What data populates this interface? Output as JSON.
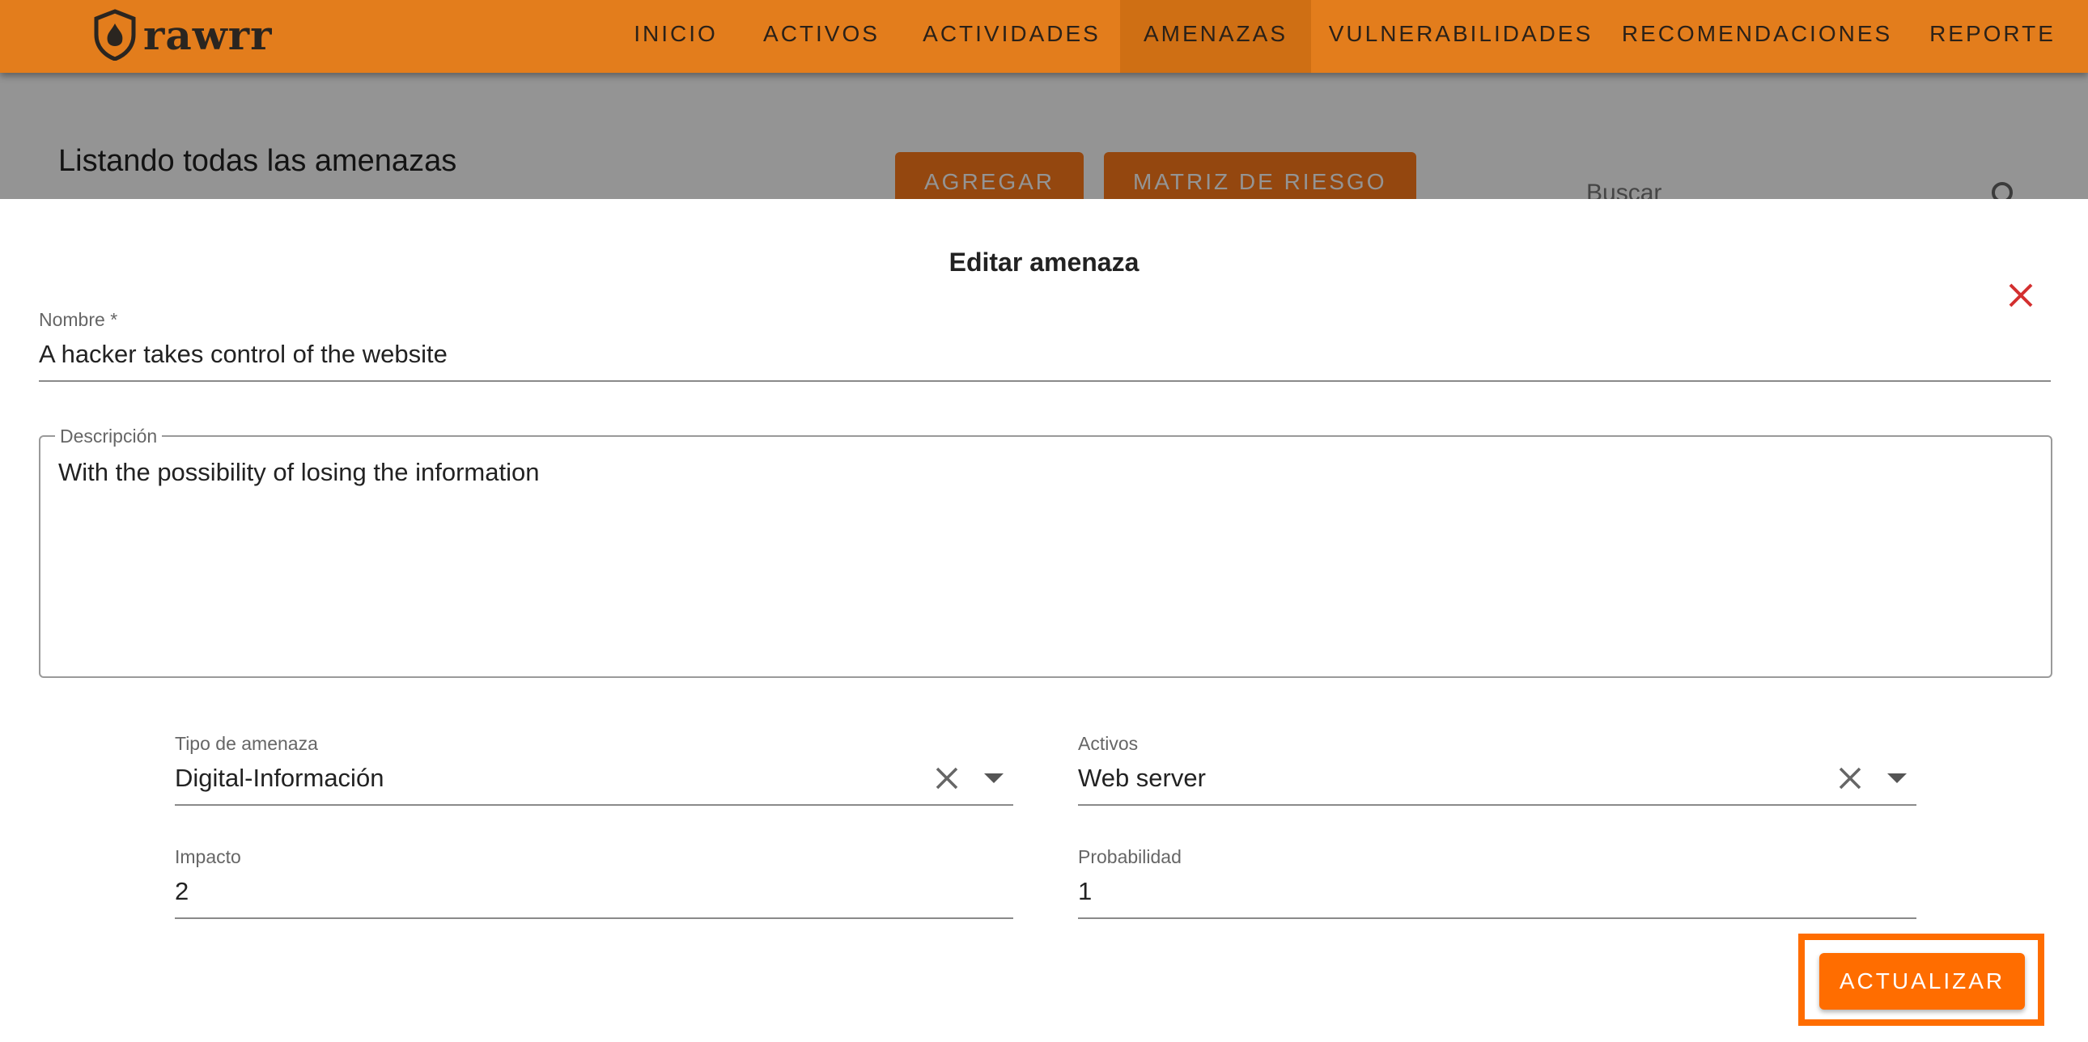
{
  "brand": {
    "name": "rawrr"
  },
  "nav": {
    "items": [
      {
        "label": "INICIO"
      },
      {
        "label": "ACTIVOS"
      },
      {
        "label": "ACTIVIDADES"
      },
      {
        "label": "AMENAZAS",
        "active": true
      },
      {
        "label": "VULNERABILIDADES"
      },
      {
        "label": "RECOMENDACIONES"
      },
      {
        "label": "REPORTE"
      }
    ]
  },
  "page": {
    "title": "Listando todas las amenazas",
    "add_button": "AGREGAR",
    "matrix_button": "MATRIZ DE RIESGO",
    "search_placeholder": "Buscar"
  },
  "dialog": {
    "title": "Editar amenaza",
    "nombre": {
      "label": "Nombre *",
      "value": "A hacker takes control of the website"
    },
    "descripcion": {
      "label": "Descripción",
      "value": "With the possibility of losing the information"
    },
    "tipo": {
      "label": "Tipo de amenaza",
      "value": "Digital-Información"
    },
    "activos": {
      "label": "Activos",
      "value": "Web server"
    },
    "impacto": {
      "label": "Impacto",
      "value": "2"
    },
    "probabilidad": {
      "label": "Probabilidad",
      "value": "1"
    },
    "update_button": "ACTUALIZAR"
  },
  "colors": {
    "nav_bg": "#e37d1c",
    "nav_active_bg": "#cf6f14",
    "accent": "#ff6d00",
    "close_icon": "#d32f2f"
  },
  "icons": [
    "shield-logo-icon",
    "search-icon",
    "close-icon",
    "clear-icon",
    "dropdown-arrow-icon"
  ]
}
